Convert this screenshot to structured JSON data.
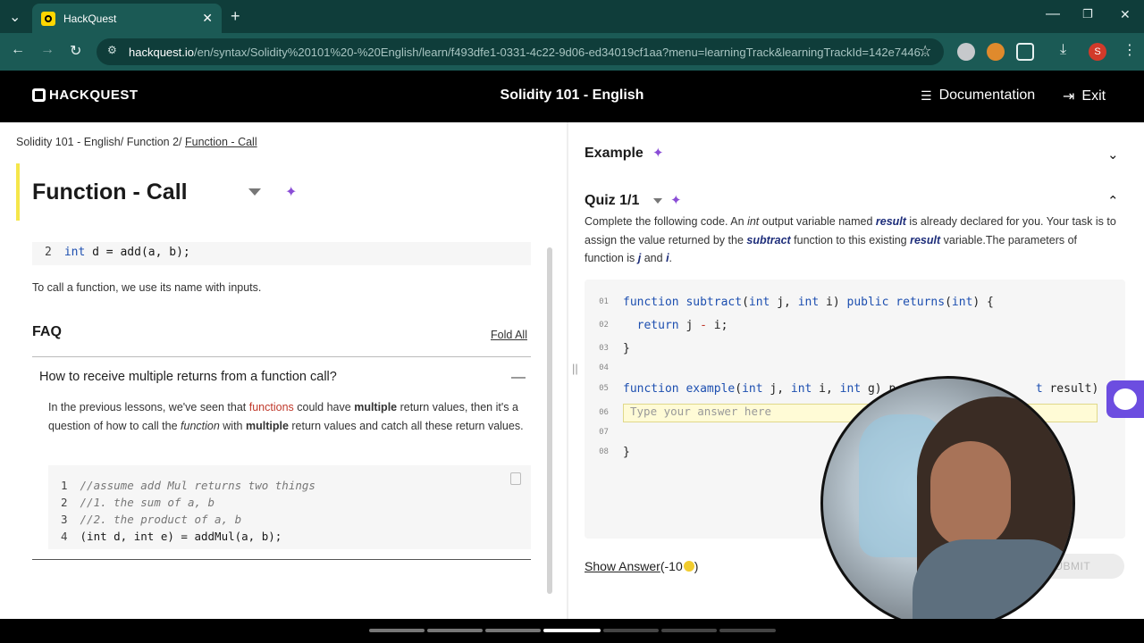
{
  "browser": {
    "tab_title": "HackQuest",
    "url_host": "hackquest.io",
    "url_path": "/en/syntax/Solidity%20101%20-%20English/learn/f493dfe1-0331-4c22-9d06-ed34019cf1aa?menu=learningTrack&learningTrackId=142e7446...",
    "profile_initial": "S"
  },
  "header": {
    "logo": "HACKQUEST",
    "course_title": "Solidity 101 - English",
    "documentation": "Documentation",
    "exit": "Exit"
  },
  "breadcrumb": {
    "items": [
      "Solidity 101 - English/",
      "Function 2/"
    ],
    "current": "Function - Call"
  },
  "lesson": {
    "title": "Function - Call",
    "code_top_line_no": "2",
    "call_text": "To call a function, we use its name with inputs."
  },
  "faq": {
    "title": "FAQ",
    "fold_all": "Fold All",
    "question": "How to receive multiple returns from a function call?",
    "answer": {
      "p1": "In the previous lessons, we've seen that ",
      "p2": "functions",
      "p3": " could have ",
      "p4": "multiple",
      "p5": " return values, then it's a question of how to call the ",
      "p6": "function",
      "p7": " with ",
      "p8": "multiple",
      "p9": " return values and catch all these return values."
    },
    "code_lines": [
      {
        "n": "1",
        "text": "//assume add Mul returns two things"
      },
      {
        "n": "2",
        "text": "//1. the sum of a, b"
      },
      {
        "n": "3",
        "text": "//2. the product of a, b"
      },
      {
        "n": "4",
        "text": "(int d, int e) = addMul(a, b);"
      }
    ]
  },
  "right": {
    "example_title": "Example",
    "quiz_title": "Quiz 1/1",
    "quiz_desc": {
      "a": "Complete the following code. An ",
      "b": "int",
      "c": " output variable named ",
      "d": "result",
      "e": " is already declared for you. Your task is to assign the value returned by the ",
      "f": "subtract",
      "g": " function to this existing ",
      "h": "result",
      "i": " variable.The parameters of function is ",
      "j": "j",
      "k": " and ",
      "l": "i",
      "m": "."
    },
    "line_numbers": [
      "01",
      "02",
      "03",
      "04",
      "05",
      "06",
      "07",
      "08"
    ],
    "answer_placeholder": "Type your answer here",
    "show_answer": "Show Answer",
    "show_answer_cost": "(-10",
    "show_answer_close": ")",
    "submit": "SUBMIT"
  },
  "colors": {
    "accent_purple": "#8a4dd6",
    "keyword_blue": "#1d4fb0",
    "highlight_yellow": "#f5e64a"
  }
}
